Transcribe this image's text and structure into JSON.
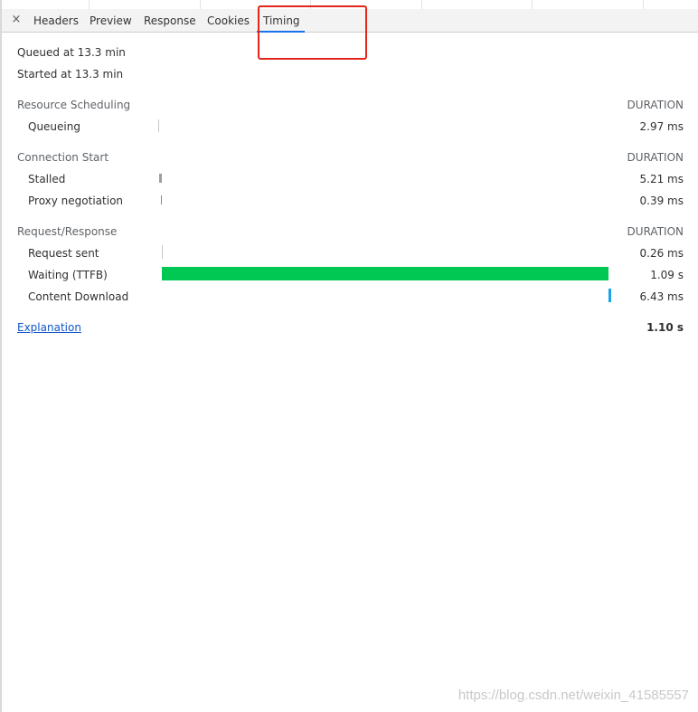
{
  "tabs": {
    "close_glyph": "×",
    "headers": "Headers",
    "preview": "Preview",
    "response": "Response",
    "cookies": "Cookies",
    "timing": "Timing"
  },
  "summary": {
    "queued": "Queued at 13.3 min",
    "started": "Started at 13.3 min"
  },
  "sections": {
    "resource_scheduling": {
      "title": "Resource Scheduling",
      "duration_label": "DURATION",
      "queueing": {
        "label": "Queueing",
        "value": "2.97 ms"
      }
    },
    "connection_start": {
      "title": "Connection Start",
      "duration_label": "DURATION",
      "stalled": {
        "label": "Stalled",
        "value": "5.21 ms"
      },
      "proxy": {
        "label": "Proxy negotiation",
        "value": "0.39 ms"
      }
    },
    "request_response": {
      "title": "Request/Response",
      "duration_label": "DURATION",
      "request_sent": {
        "label": "Request sent",
        "value": "0.26 ms"
      },
      "waiting": {
        "label": "Waiting (TTFB)",
        "value": "1.09 s"
      },
      "download": {
        "label": "Content Download",
        "value": "6.43 ms"
      }
    }
  },
  "footer": {
    "explanation": "Explanation",
    "total": "1.10 s"
  },
  "colors": {
    "waiting_bar": "#00c853",
    "download_bar": "#1aa3e8",
    "stalled_bar": "#9e9e9e",
    "highlight": "#e3261d"
  },
  "watermark": "https://blog.csdn.net/weixin_41585557"
}
